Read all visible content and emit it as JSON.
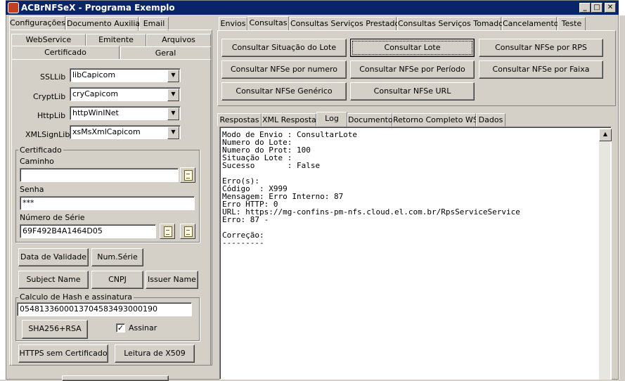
{
  "window": {
    "title": "ACBrNFSeX - Programa Exemplo",
    "minimize": "_",
    "maximize": "□",
    "close": "✕"
  },
  "left": {
    "top_tabs": [
      "Configurações",
      "Documento Auxiliar",
      "Email"
    ],
    "sub_tabs_row1": [
      "WebService",
      "Emitente",
      "Arquivos"
    ],
    "sub_tabs_row2": [
      "Certificado",
      "Geral"
    ],
    "ssllib": {
      "label": "SSLLib",
      "value": "libCapicom"
    },
    "cryptlib": {
      "label": "CryptLib",
      "value": "cryCapicom"
    },
    "httplib": {
      "label": "HttpLib",
      "value": "httpWinINet"
    },
    "xmlsignlib": {
      "label": "XMLSignLib",
      "value": "xsMsXmlCapicom"
    },
    "certificado": {
      "title": "Certificado",
      "caminho_label": "Caminho",
      "caminho_value": "",
      "senha_label": "Senha",
      "senha_value": "***",
      "numserie_label": "Número de Série",
      "numserie_value": "69F492B4A1464D05"
    },
    "buttons": {
      "data_validade": "Data de Validade",
      "num_serie": "Num.Série",
      "subject_name": "Subject Name",
      "cnpj": "CNPJ",
      "issuer_name": "Issuer Name"
    },
    "hash": {
      "title": "Calculo de Hash e assinatura",
      "value": "05481336000137045834930001​90",
      "sha_button": "SHA256+RSA",
      "assinar_label": "Assinar",
      "assinar_checked": "✓"
    },
    "https_button": "HTTPS sem Certificado",
    "x509_button": "Leitura de X509"
  },
  "right": {
    "top_tabs": [
      "Envios",
      "Consultas",
      "Consultas Serviços Prestados",
      "Consultas Serviços Tomados",
      "Cancelamento",
      "Teste"
    ],
    "actions": [
      "Consultar Situação do Lote",
      "Consultar Lote",
      "Consultar NFSe por RPS",
      "Consultar NFSe por numero",
      "Consultar NFSe por Período",
      "Consultar NFSe por Faixa",
      "Consultar NFSe Genérico",
      "Consultar NFSe URL"
    ],
    "result_tabs": [
      "Respostas",
      "XML Resposta",
      "Log",
      "Documento",
      "Retorno Completo WS",
      "Dados"
    ],
    "log_text": "Modo de Envio : ConsultarLote\nNumero do Lote:\nNumero do Prot: 100\nSituação Lote :\nSucesso       : False\n\nErro(s):\nCódigo  : X999\nMensagem: Erro Interno: 87\nErro HTTP: 0\nURL: https://mg-confins-pm-nfs.cloud.el.com.br/RpsServiceService\nErro: 87 -\n\nCorreção:\n---------"
  }
}
